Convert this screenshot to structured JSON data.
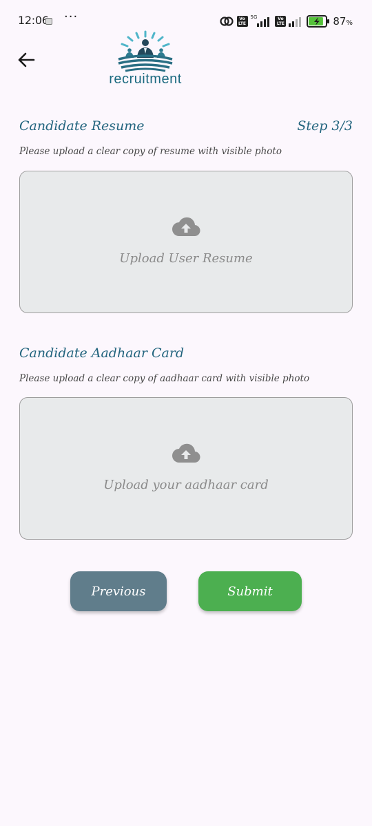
{
  "status_bar": {
    "time": "12:06",
    "dots": "···",
    "network_5g": "5G",
    "volte": "Vo LTE",
    "battery_percent": "87",
    "battery_unit": "%",
    "battery_level": 0.87
  },
  "header": {
    "back_icon": "arrow-left-icon",
    "logo_text": "recruitment"
  },
  "resume_section": {
    "title": "Candidate Resume",
    "step": "Step 3/3",
    "hint": "Please upload a clear copy of resume with visible photo",
    "upload_icon": "cloud-upload-icon",
    "upload_label": "Upload User Resume"
  },
  "aadhaar_section": {
    "title": "Candidate Aadhaar Card",
    "hint": "Please upload a clear copy of aadhaar card with visible photo",
    "upload_icon": "cloud-upload-icon",
    "upload_label": "Upload your aadhaar card"
  },
  "actions": {
    "previous_label": "Previous",
    "submit_label": "Submit"
  },
  "colors": {
    "background": "#fcf7fd",
    "accent_text": "#22647e",
    "previous_button": "#607d8b",
    "submit_button": "#4caf50",
    "upload_box": "#e8eaeb"
  }
}
